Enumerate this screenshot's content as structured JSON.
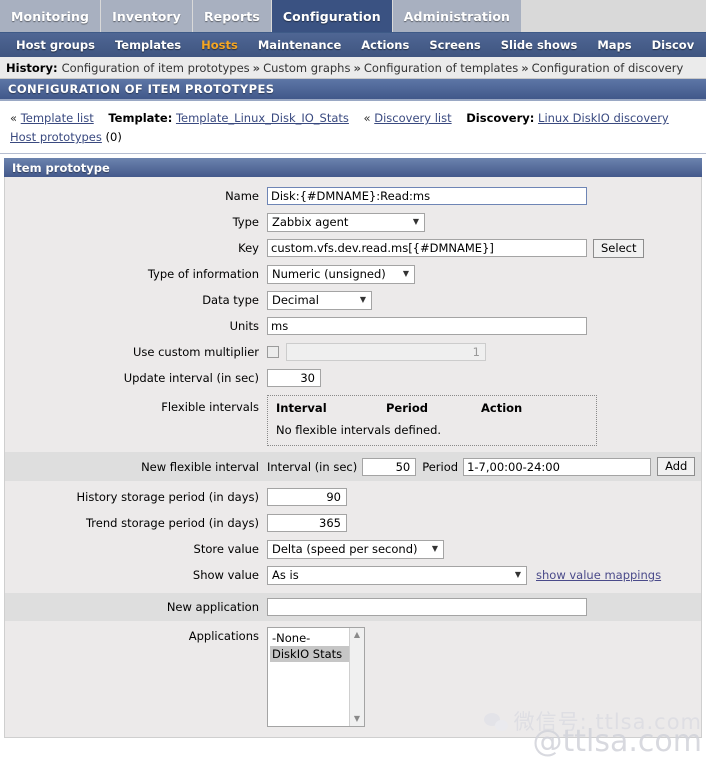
{
  "topmenu": {
    "items": [
      {
        "label": "Monitoring",
        "selected": false
      },
      {
        "label": "Inventory",
        "selected": false
      },
      {
        "label": "Reports",
        "selected": false
      },
      {
        "label": "Configuration",
        "selected": true
      },
      {
        "label": "Administration",
        "selected": false
      }
    ]
  },
  "subnav": {
    "items": [
      {
        "label": "Host groups",
        "active": false
      },
      {
        "label": "Templates",
        "active": false
      },
      {
        "label": "Hosts",
        "active": true
      },
      {
        "label": "Maintenance",
        "active": false
      },
      {
        "label": "Actions",
        "active": false
      },
      {
        "label": "Screens",
        "active": false
      },
      {
        "label": "Slide shows",
        "active": false
      },
      {
        "label": "Maps",
        "active": false
      },
      {
        "label": "Discov",
        "active": false
      }
    ]
  },
  "history": {
    "label": "History:",
    "separator": "»",
    "items": [
      "Configuration of item prototypes",
      "Custom graphs",
      "Configuration of templates",
      "Configuration of discovery"
    ]
  },
  "page_title": "CONFIGURATION OF ITEM PROTOTYPES",
  "breadcrumb": {
    "template_list_link": "Template list",
    "template_label": "Template:",
    "template_name": "Template_Linux_Disk_IO_Stats",
    "discovery_list_link": "Discovery list",
    "discovery_label": "Discovery:",
    "discovery_name": "Linux DiskIO discovery",
    "host_prototypes_link": "Host prototypes",
    "host_prototypes_count": "(0)",
    "guillemet": "«"
  },
  "form": {
    "header": "Item prototype",
    "name": {
      "label": "Name",
      "value": "Disk:{#DMNAME}:Read:ms"
    },
    "type": {
      "label": "Type",
      "value": "Zabbix agent"
    },
    "key": {
      "label": "Key",
      "value": "custom.vfs.dev.read.ms[{#DMNAME}]",
      "select_button": "Select"
    },
    "type_of_information": {
      "label": "Type of information",
      "value": "Numeric (unsigned)"
    },
    "data_type": {
      "label": "Data type",
      "value": "Decimal"
    },
    "units": {
      "label": "Units",
      "value": "ms"
    },
    "custom_multiplier": {
      "label": "Use custom multiplier",
      "checked": false,
      "value": "1"
    },
    "update_interval": {
      "label": "Update interval (in sec)",
      "value": "30"
    },
    "flexible_intervals": {
      "label": "Flexible intervals",
      "columns": [
        "Interval",
        "Period",
        "Action"
      ],
      "empty_text": "No flexible intervals defined."
    },
    "new_flexible_interval": {
      "label": "New flexible interval",
      "interval_label": "Interval (in sec)",
      "interval_value": "50",
      "period_label": "Period",
      "period_value": "1-7,00:00-24:00",
      "add_button": "Add"
    },
    "history_storage": {
      "label": "History storage period (in days)",
      "value": "90"
    },
    "trend_storage": {
      "label": "Trend storage period (in days)",
      "value": "365"
    },
    "store_value": {
      "label": "Store value",
      "value": "Delta (speed per second)"
    },
    "show_value": {
      "label": "Show value",
      "value": "As is",
      "link": "show value mappings"
    },
    "new_application": {
      "label": "New application",
      "value": ""
    },
    "applications": {
      "label": "Applications",
      "options": [
        {
          "label": "-None-",
          "selected": false
        },
        {
          "label": "DiskIO Stats",
          "selected": true
        }
      ]
    }
  },
  "watermark": {
    "line1": "微信号: ttlsa.com",
    "line2": "@ttlsa.com"
  }
}
